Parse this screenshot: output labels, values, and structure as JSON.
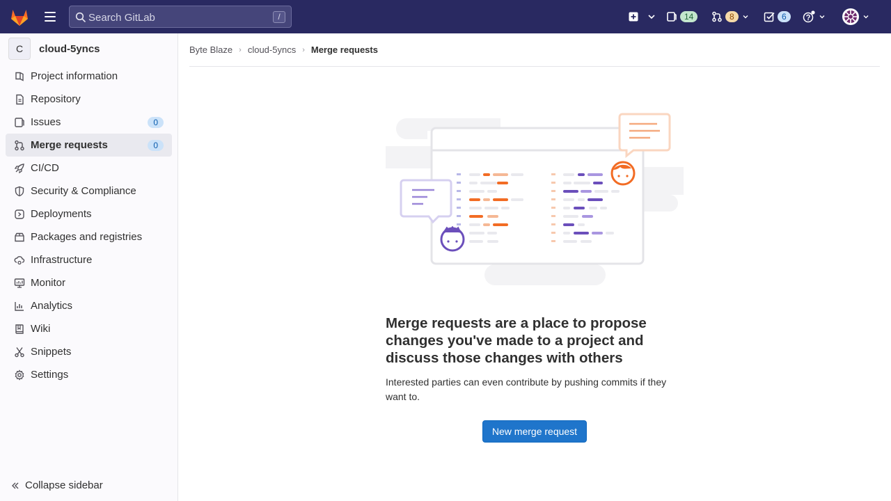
{
  "topbar": {
    "search_placeholder": "Search GitLab",
    "search_shortcut": "/",
    "issues_count": "14",
    "merge_requests_count": "8",
    "todos_count": "6"
  },
  "sidebar": {
    "project_initial": "C",
    "project_name": "cloud-5yncs",
    "items": [
      {
        "label": "Project information",
        "icon": "project-info-icon"
      },
      {
        "label": "Repository",
        "icon": "repository-icon"
      },
      {
        "label": "Issues",
        "icon": "issues-icon",
        "count": "0"
      },
      {
        "label": "Merge requests",
        "icon": "merge-request-icon",
        "count": "0",
        "active": true
      },
      {
        "label": "CI/CD",
        "icon": "rocket-icon"
      },
      {
        "label": "Security & Compliance",
        "icon": "shield-icon"
      },
      {
        "label": "Deployments",
        "icon": "deployments-icon"
      },
      {
        "label": "Packages and registries",
        "icon": "package-icon"
      },
      {
        "label": "Infrastructure",
        "icon": "cloud-gear-icon"
      },
      {
        "label": "Monitor",
        "icon": "monitor-icon"
      },
      {
        "label": "Analytics",
        "icon": "chart-icon"
      },
      {
        "label": "Wiki",
        "icon": "book-icon"
      },
      {
        "label": "Snippets",
        "icon": "scissors-icon"
      },
      {
        "label": "Settings",
        "icon": "gear-icon"
      }
    ],
    "collapse_label": "Collapse sidebar"
  },
  "breadcrumb": {
    "items": [
      "Byte Blaze",
      "cloud-5yncs",
      "Merge requests"
    ]
  },
  "empty_state": {
    "title": "Merge requests are a place to propose changes you've made to a project and discuss those changes with others",
    "description": "Interested parties can even contribute by pushing commits if they want to.",
    "button_label": "New merge request"
  },
  "colors": {
    "topbar_bg": "#292961",
    "primary_button": "#1f75cb",
    "sidebar_bg": "#fbfafd"
  }
}
